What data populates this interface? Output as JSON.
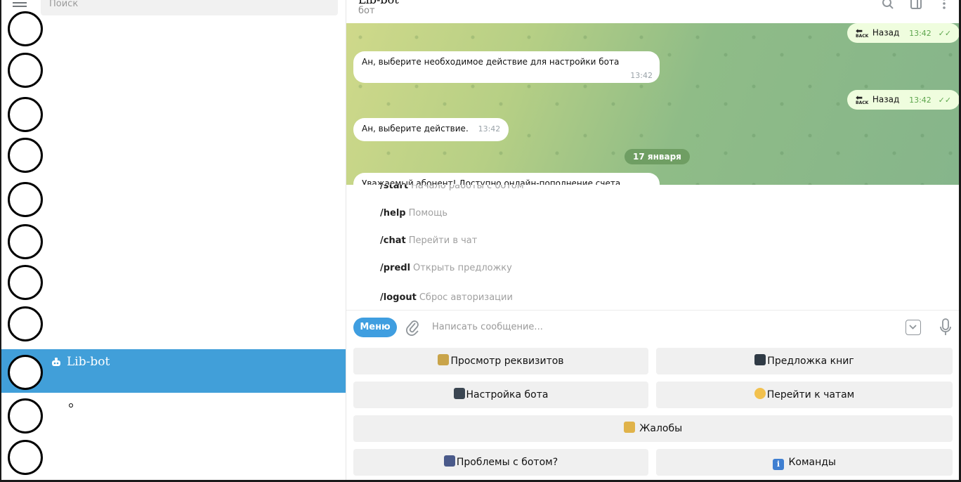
{
  "sidebar": {
    "search_placeholder": "Поиск",
    "active_chat": {
      "name": "Lib-bot"
    }
  },
  "chat_header": {
    "title": "Lib-bot",
    "subtitle": "бот"
  },
  "messages": [
    {
      "direction": "out",
      "text": "Назад",
      "time": "13:42",
      "icon": "back-icon"
    },
    {
      "direction": "in",
      "text": "Ан, выберите необходимое действие для настройки бота",
      "time": "13:42"
    },
    {
      "direction": "out",
      "text": "Назад",
      "time": "13:42",
      "icon": "back-icon"
    },
    {
      "direction": "in",
      "text": "Ан, выберите действие.",
      "time": "13:42"
    }
  ],
  "back_icon_text": "BACK",
  "date_divider": "17 января",
  "partial_message": "Уважаемый абонент! Доступно онлайн-пополнение счета",
  "commands": [
    {
      "name": "/start",
      "desc": "Начало работы с ботом"
    },
    {
      "name": "/help",
      "desc": "Помощь"
    },
    {
      "name": "/chat",
      "desc": "Перейти в чат"
    },
    {
      "name": "/predl",
      "desc": "Открыть предложку"
    },
    {
      "name": "/logout",
      "desc": "Сброс авторизации"
    }
  ],
  "composer": {
    "menu_label": "Меню",
    "placeholder": "Написать сообщение..."
  },
  "keyboard": [
    {
      "label": "Просмотр реквизитов",
      "emoji": "money-bag-icon"
    },
    {
      "label": "Предложка книг",
      "emoji": "monitor-icon"
    },
    {
      "label": "Настройка бота",
      "emoji": "phone-arrow-icon"
    },
    {
      "label": "Перейти к чатам",
      "emoji": "thumbs-up-icon"
    },
    {
      "label": "Жалобы",
      "emoji": "person-desk-icon"
    },
    {
      "label": "Проблемы с ботом?",
      "emoji": "satellite-icon"
    },
    {
      "label": "Команды",
      "emoji": "info-icon"
    }
  ],
  "colors": {
    "accent": "#419fd9",
    "menu_button": "#3f9ee0",
    "outgoing_bubble": "#effdde",
    "date_pill": "#6f9e63"
  }
}
